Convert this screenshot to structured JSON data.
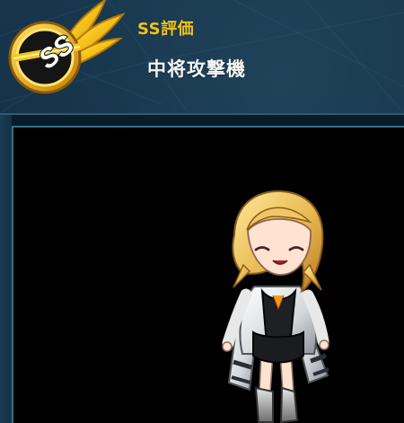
{
  "rank": {
    "title": "SS評価",
    "badge_text": "SS"
  },
  "unit": {
    "name": "中将攻撃機"
  },
  "colors": {
    "accent_gold": "#f3c21b",
    "background_navy": "#0f2a3d",
    "preview_black": "#000000"
  },
  "icons": {
    "rank_badge": "winged-ss-rank-icon",
    "character": "chibi-character-sprite"
  }
}
